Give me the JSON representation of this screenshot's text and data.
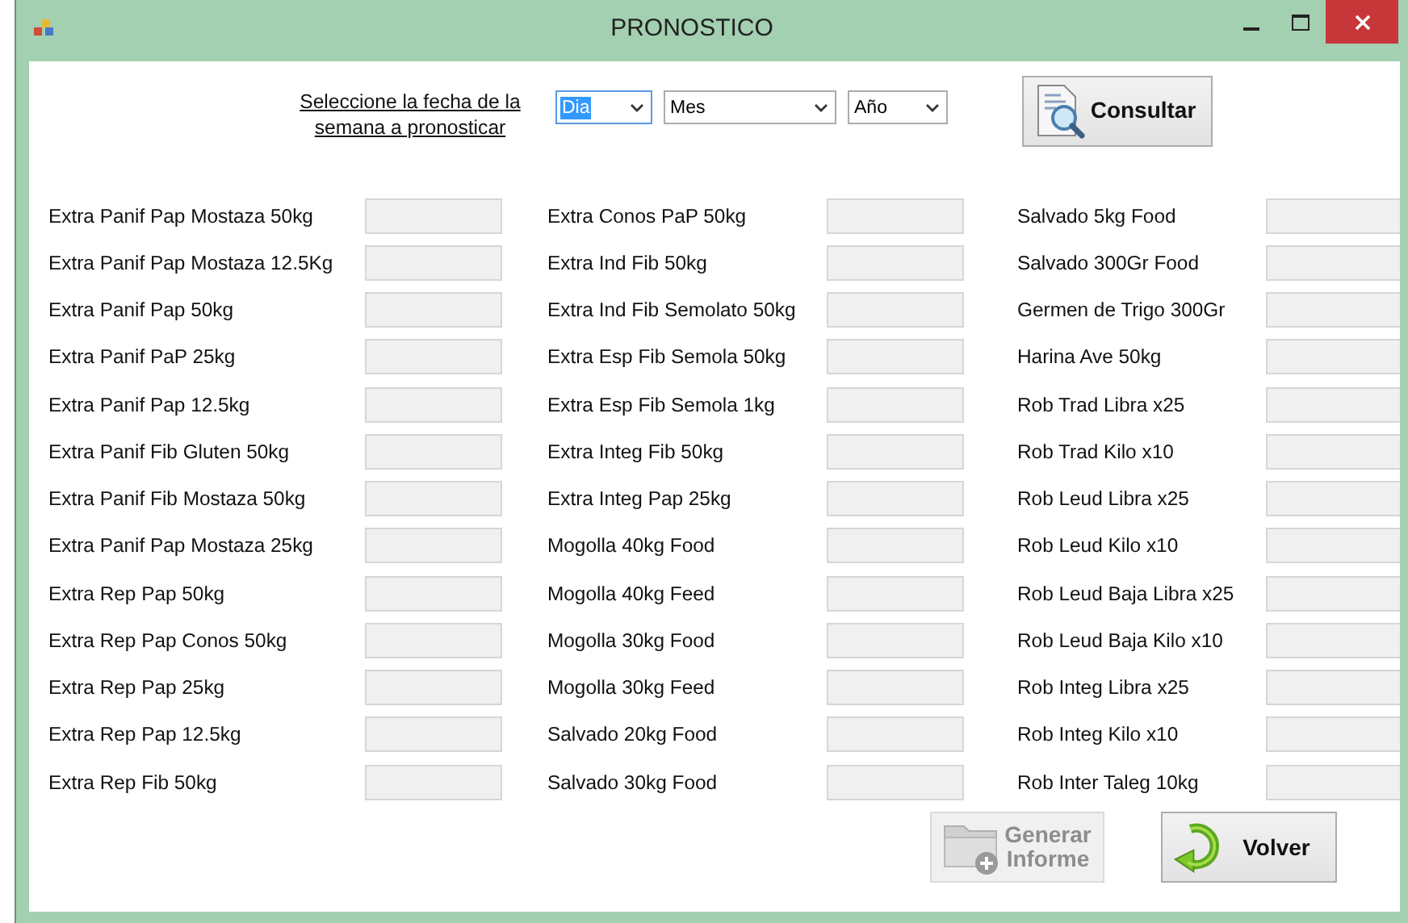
{
  "window": {
    "title": "PRONOSTICO"
  },
  "date_prompt": "Seleccione la fecha de la semana a pronosticar",
  "date_selectors": [
    {
      "value": "Dia",
      "selected": true
    },
    {
      "value": "Mes",
      "selected": false
    },
    {
      "value": "Año",
      "selected": false
    }
  ],
  "query_button": {
    "label": "Consultar"
  },
  "product_columns": [
    {
      "items": [
        {
          "label": "Extra Panif Pap Mostaza 50kg"
        },
        {
          "label": "Extra Panif Pap Mostaza 12.5Kg"
        },
        {
          "label": "Extra Panif Pap 50kg"
        },
        {
          "label": "Extra Panif PaP 25kg"
        },
        {
          "label": "Extra Panif Pap 12.5kg"
        },
        {
          "label": "Extra Panif Fib Gluten 50kg"
        },
        {
          "label": "Extra Panif Fib Mostaza 50kg"
        },
        {
          "label": "Extra Panif Pap Mostaza 25kg"
        },
        {
          "label": "Extra Rep Pap 50kg"
        },
        {
          "label": "Extra Rep Pap Conos 50kg"
        },
        {
          "label": "Extra Rep Pap 25kg"
        },
        {
          "label": "Extra Rep Pap 12.5kg"
        },
        {
          "label": "Extra Rep Fib 50kg"
        }
      ]
    },
    {
      "items": [
        {
          "label": "Extra Conos PaP 50kg"
        },
        {
          "label": "Extra Ind Fib 50kg"
        },
        {
          "label": "Extra Ind Fib Semolato 50kg"
        },
        {
          "label": "Extra Esp Fib Semola 50kg"
        },
        {
          "label": "Extra Esp Fib Semola 1kg"
        },
        {
          "label": "Extra Integ Fib 50kg"
        },
        {
          "label": "Extra Integ Pap 25kg"
        },
        {
          "label": "Mogolla 40kg Food"
        },
        {
          "label": "Mogolla 40kg Feed"
        },
        {
          "label": "Mogolla 30kg Food"
        },
        {
          "label": "Mogolla 30kg Feed"
        },
        {
          "label": "Salvado 20kg Food"
        },
        {
          "label": "Salvado 30kg Food"
        }
      ]
    },
    {
      "items": [
        {
          "label": "Salvado 5kg Food"
        },
        {
          "label": "Salvado 300Gr Food"
        },
        {
          "label": "Germen de Trigo 300Gr"
        },
        {
          "label": "Harina Ave 50kg"
        },
        {
          "label": "Rob Trad Libra x25"
        },
        {
          "label": "Rob Trad Kilo x10"
        },
        {
          "label": "Rob Leud Libra x25"
        },
        {
          "label": "Rob Leud Kilo x10"
        },
        {
          "label": "Rob Leud Baja Libra x25"
        },
        {
          "label": "Rob Leud Baja Kilo x10"
        },
        {
          "label": "Rob Integ Libra x25"
        },
        {
          "label": "Rob Integ Kilo x10"
        },
        {
          "label": "Rob Inter Taleg 10kg"
        }
      ]
    }
  ],
  "buttons": [
    {
      "kind": "report",
      "label": "Generar Informe",
      "disabled": true
    },
    {
      "kind": "back",
      "label": "Volver",
      "disabled": false
    }
  ]
}
